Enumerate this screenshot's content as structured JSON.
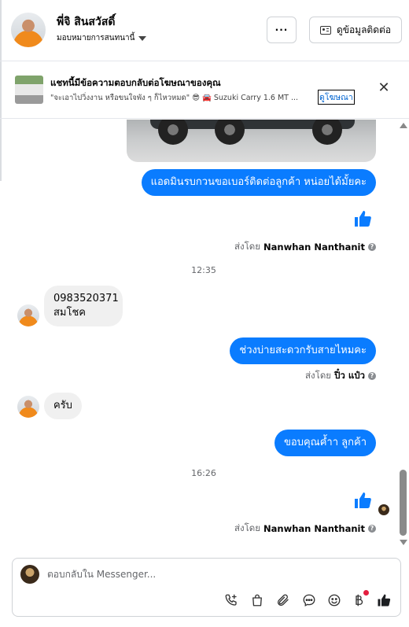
{
  "header": {
    "contact_name": "พี่จิ สินสวัสดิ์",
    "assign_label": "มอบหมายการสนทนานี้",
    "more_label": "···",
    "contact_info_label": "ดูข้อมูลติดต่อ"
  },
  "ad_banner": {
    "title": "แชทนี้มีข้อความตอบกลับต่อโฆษณาของคุณ",
    "subtitle": "\"จะเอาไปวิ่งงาน หรือขนใจพัง ๆ ก็ไหวหมด\" 😎 🚘 Suzuki Carry 1.6 MT ...",
    "link_label": "ดูโฆษณา"
  },
  "messages": {
    "m1": "แอดมินรบกวนขอเบอร์ติดต่อลูกค้า หน่อยได้มั้ยคะ",
    "sent_by_1_prefix": "ส่งโดย",
    "sent_by_1_name": "Nanwhan Nanthanit",
    "time_1": "12:35",
    "m2_line1": "0983520371",
    "m2_line2": "สมโชค",
    "m3": "ช่วงบ่ายสะดวกรับสายไหมคะ",
    "sent_by_2_prefix": "ส่งโดย",
    "sent_by_2_name": "ปิ๋ว แป๋ว",
    "m4": "ครับ",
    "m5": "ขอบคุณค้ำา ลูกค้า",
    "time_2": "16:26",
    "sent_by_3_prefix": "ส่งโดย",
    "sent_by_3_name": "Nanwhan Nanthanit"
  },
  "composer": {
    "placeholder": "ตอบกลับใน Messenger..."
  },
  "colors": {
    "outgoing_bubble": "#0a7cff",
    "incoming_bubble": "#f0f0f0",
    "like_blue": "#0a7cff",
    "notification_red": "#e41e3f"
  },
  "icons": [
    "more-icon",
    "contact-card-icon",
    "close-icon",
    "like-icon",
    "call-add-icon",
    "shopping-bag-icon",
    "attachment-icon",
    "chat-bubble-icon",
    "emoji-icon",
    "baht-icon",
    "thumbs-up-icon"
  ]
}
